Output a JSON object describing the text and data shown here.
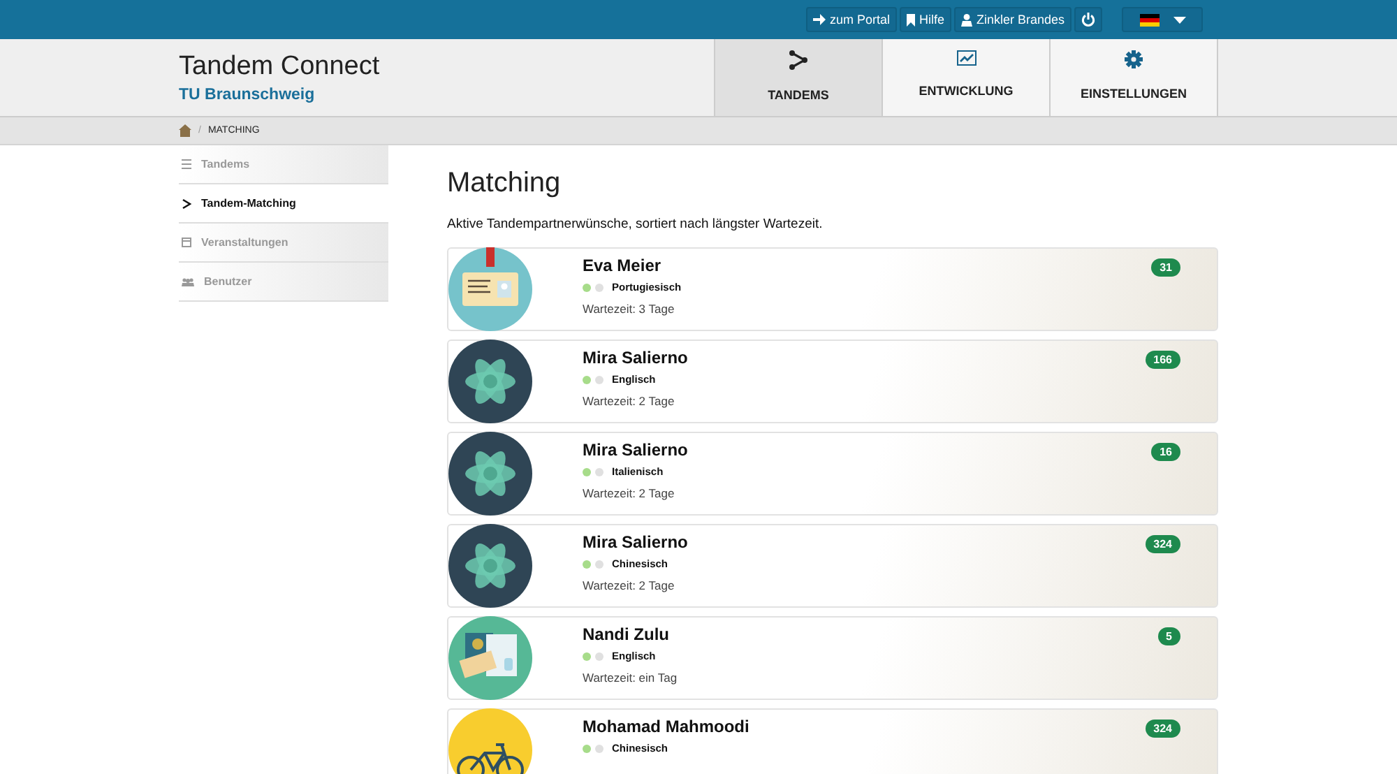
{
  "topbar": {
    "buttons": [
      {
        "kind": "portal",
        "label": "zum Portal"
      },
      {
        "kind": "help",
        "label": "Hilfe"
      },
      {
        "kind": "user",
        "label": "Zinkler Brandes"
      },
      {
        "kind": "power"
      }
    ],
    "language": {
      "kind": "de"
    }
  },
  "header": {
    "title": "Tandem Connect",
    "subtitle": "TU Braunschweig"
  },
  "tabs": [
    {
      "kind": "tandems",
      "label": "TANDEMS",
      "selected": true
    },
    {
      "kind": "chart",
      "label": "ENTWICKLUNG",
      "selected": false
    },
    {
      "kind": "gear",
      "label": "EINSTELLUNGEN",
      "selected": false
    }
  ],
  "breadcrumb": {
    "separator": "/",
    "items": [
      "MATCHING"
    ]
  },
  "sidebar": {
    "items": [
      {
        "kind": "list",
        "label": "Tandems",
        "selected": false
      },
      {
        "kind": "chevron",
        "label": "Tandem-Matching",
        "selected": true
      },
      {
        "kind": "calendar",
        "label": "Veranstaltungen",
        "selected": false
      },
      {
        "kind": "users",
        "label": "Benutzer",
        "selected": false
      }
    ]
  },
  "main": {
    "title": "Matching",
    "intro": "Aktive Tandempartnerwünsche, sortiert nach längster Wartezeit.",
    "requests": [
      {
        "kind": "badge",
        "name": "Eva Meier",
        "language": "Portugiesisch",
        "wait": "Wartezeit: 3 Tage",
        "count": "31"
      },
      {
        "kind": "atom",
        "name": "Mira Salierno",
        "language": "Englisch",
        "wait": "Wartezeit: 2 Tage",
        "count": "166"
      },
      {
        "kind": "atom",
        "name": "Mira Salierno",
        "language": "Italienisch",
        "wait": "Wartezeit: 2 Tage",
        "count": "16"
      },
      {
        "kind": "atom",
        "name": "Mira Salierno",
        "language": "Chinesisch",
        "wait": "Wartezeit: 2 Tage",
        "count": "324"
      },
      {
        "kind": "travel",
        "name": "Nandi Zulu",
        "language": "Englisch",
        "wait": "Wartezeit: ein Tag",
        "count": "5"
      },
      {
        "kind": "bicycle",
        "name": "Mohamad Mahmoodi",
        "language": "Chinesisch",
        "count": "324"
      }
    ]
  }
}
